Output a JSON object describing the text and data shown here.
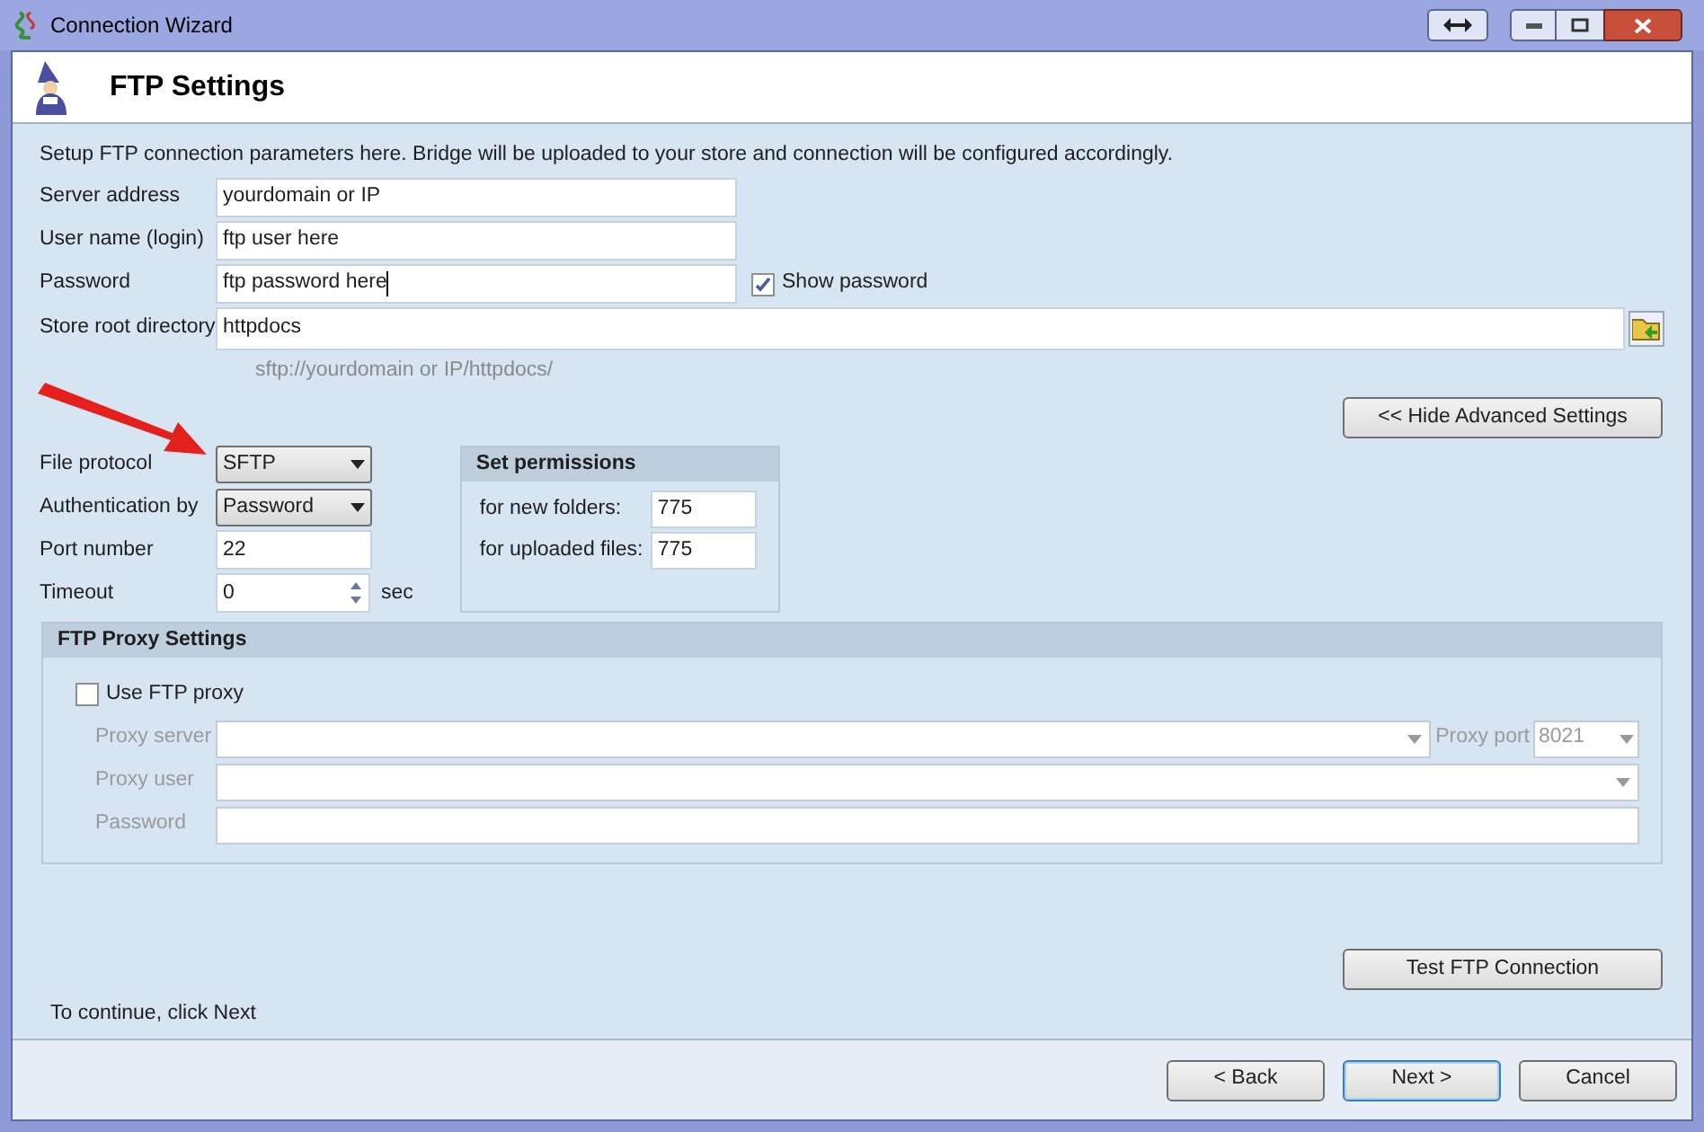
{
  "window": {
    "title": "Connection Wizard"
  },
  "header": {
    "title": "FTP Settings"
  },
  "intro": "Setup FTP connection parameters here. Bridge will be uploaded to your store and connection will be configured accordingly.",
  "fields": [
    {
      "label": "Server address",
      "value": "yourdomain or IP",
      "kind": "text"
    },
    {
      "label": "User name (login)",
      "value": "ftp user here",
      "kind": "text"
    },
    {
      "label": "Password",
      "value": "ftp password here",
      "kind": "password",
      "show_password": {
        "label": "Show password",
        "checked": true
      }
    },
    {
      "label": "Store root directory",
      "value": "httpdocs",
      "kind": "folder",
      "hint": "sftp://yourdomain or IP/httpdocs/"
    }
  ],
  "advanced_button": "<< Hide Advanced Settings",
  "connection": [
    {
      "label": "File protocol",
      "value": "SFTP",
      "kind": "select"
    },
    {
      "label": "Authentication by",
      "value": "Password",
      "kind": "select"
    },
    {
      "label": "Port number",
      "value": "22",
      "kind": "text"
    },
    {
      "label": "Timeout",
      "value": "0",
      "kind": "spin",
      "unit": "sec"
    }
  ],
  "permissions": {
    "title": "Set permissions",
    "rows": [
      {
        "label": "for new folders:",
        "value": "775"
      },
      {
        "label": "for uploaded files:",
        "value": "775"
      }
    ]
  },
  "proxy": {
    "title": "FTP Proxy Settings",
    "use": {
      "label": "Use FTP proxy",
      "checked": false
    },
    "disabled": true,
    "fields": [
      {
        "label": "Proxy server",
        "kind": "combo",
        "port": {
          "label": "Proxy port",
          "value": "8021"
        }
      },
      {
        "label": "Proxy user",
        "kind": "combo"
      },
      {
        "label": "Password",
        "kind": "text"
      }
    ]
  },
  "test_button": "Test FTP Connection",
  "footer_note": "To continue, click Next",
  "buttons": [
    {
      "label": "< Back",
      "default": false
    },
    {
      "label": "Next >",
      "default": true
    },
    {
      "label": "Cancel",
      "default": false
    }
  ]
}
